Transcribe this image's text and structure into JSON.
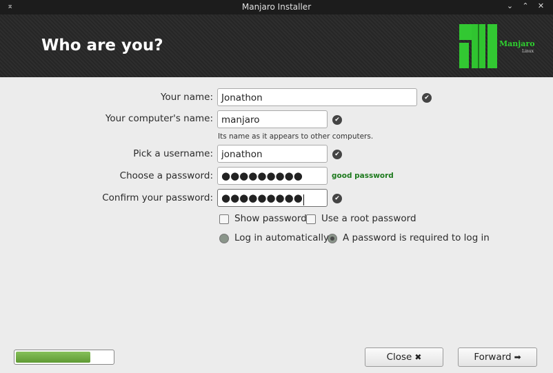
{
  "window": {
    "title": "Manjaro Installer",
    "menu_icon": "⌅",
    "controls": [
      "⌄",
      "⌃",
      "✕"
    ]
  },
  "header": {
    "title": "Who are you?",
    "logo_brand": "Manjaro",
    "logo_sub": "Linux",
    "logo_color": "#32c832"
  },
  "form": {
    "name_label": "Your name:",
    "name_value": "Jonathon",
    "computer_label": "Your computer's name:",
    "computer_value": "manjaro",
    "computer_hint": "Its name as it appears to other computers.",
    "username_label": "Pick a username:",
    "username_value": "jonathon",
    "password_label": "Choose a password:",
    "password_value": "●●●●●●●●●",
    "password_strength": "good password",
    "confirm_label": "Confirm your password:",
    "confirm_value": "●●●●●●●●●",
    "check_icon": "✔"
  },
  "options": {
    "show_password": "Show password",
    "show_password_checked": false,
    "root_password": "Use a root password",
    "root_password_checked": false,
    "login_auto": "Log in automatically",
    "login_password": "A password is required to log in",
    "login_selected": "password"
  },
  "footer": {
    "progress_fraction": 0.77,
    "close_label": "Close",
    "close_icon": "✖",
    "forward_label": "Forward",
    "forward_icon": "➡"
  }
}
